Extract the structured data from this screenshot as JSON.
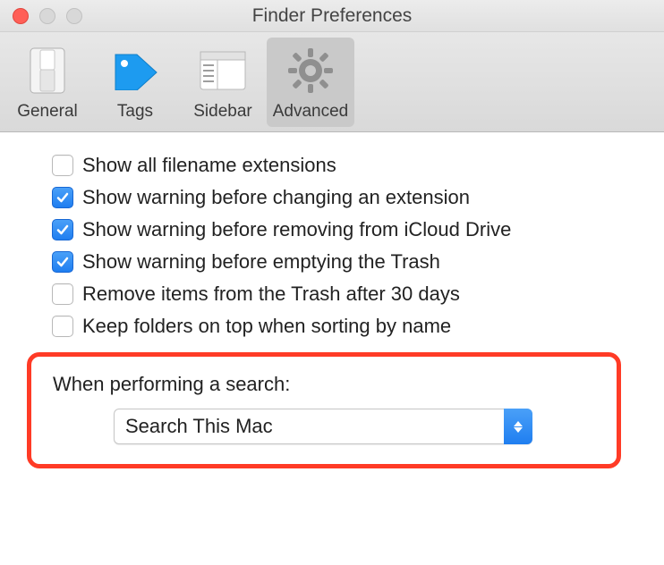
{
  "window": {
    "title": "Finder Preferences"
  },
  "toolbar": {
    "items": [
      {
        "label": "General"
      },
      {
        "label": "Tags"
      },
      {
        "label": "Sidebar"
      },
      {
        "label": "Advanced"
      }
    ],
    "active_index": 3
  },
  "options": [
    {
      "checked": false,
      "label": "Show all filename extensions"
    },
    {
      "checked": true,
      "label": "Show warning before changing an extension"
    },
    {
      "checked": true,
      "label": "Show warning before removing from iCloud Drive"
    },
    {
      "checked": true,
      "label": "Show warning before emptying the Trash"
    },
    {
      "checked": false,
      "label": "Remove items from the Trash after 30 days"
    },
    {
      "checked": false,
      "label": "Keep folders on top when sorting by name"
    }
  ],
  "search": {
    "label": "When performing a search:",
    "selected": "Search This Mac"
  }
}
